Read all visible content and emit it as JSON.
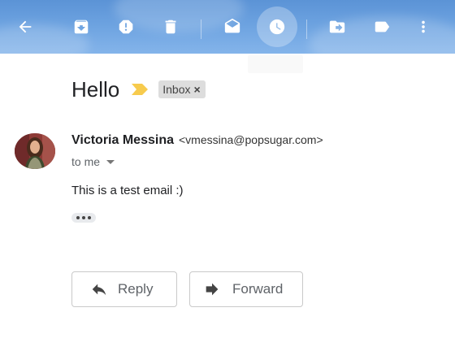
{
  "toolbar": {
    "buttons": [
      {
        "icon": "back-arrow-icon",
        "label": "Back"
      },
      {
        "icon": "archive-icon",
        "label": "Archive"
      },
      {
        "icon": "report-spam-icon",
        "label": "Report spam"
      },
      {
        "icon": "trash-icon",
        "label": "Delete"
      },
      {
        "icon": "mark-unread-icon",
        "label": "Mark as unread"
      },
      {
        "icon": "snooze-clock-icon",
        "label": "Snooze"
      },
      {
        "icon": "move-to-icon",
        "label": "Move to"
      },
      {
        "icon": "label-icon",
        "label": "Labels"
      },
      {
        "icon": "more-vert-icon",
        "label": "More"
      }
    ],
    "active_button": "snooze-clock-icon",
    "colors": {
      "top": "#5b93d6",
      "bottom": "#84b4ea",
      "icon": "#ffffff"
    }
  },
  "message": {
    "subject": "Hello",
    "importance_color": "#f7cb4d",
    "label": {
      "text": "Inbox",
      "remove_glyph": "×"
    },
    "sender": {
      "name": "Victoria Messina",
      "email": "<vmessina@popsugar.com>"
    },
    "recipient": "to me",
    "body": "This is a test email :)"
  },
  "actions": {
    "reply": "Reply",
    "forward": "Forward"
  }
}
